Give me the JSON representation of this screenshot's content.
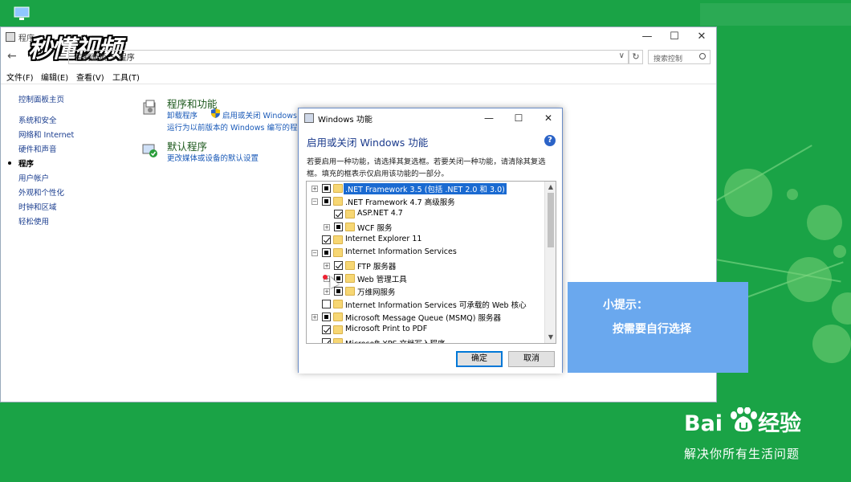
{
  "brand": {
    "watermark": "秒懂视频",
    "baidu_prefix": "Bai",
    "baidu_suffix": "经验",
    "baidu_slogan": "解决你所有生活问题"
  },
  "control_panel": {
    "title": "程序",
    "address_path": "控制面板 > 程序",
    "search_placeholder": "搜索控制",
    "menu": [
      "文件(F)",
      "编辑(E)",
      "查看(V)",
      "工具(T)"
    ],
    "sidebar": [
      {
        "label": "控制面板主页",
        "active": false
      },
      {
        "label": "系统和安全",
        "active": false
      },
      {
        "label": "网络和 Internet",
        "active": false
      },
      {
        "label": "硬件和声音",
        "active": false
      },
      {
        "label": "程序",
        "active": true
      },
      {
        "label": "用户帐户",
        "active": false
      },
      {
        "label": "外观和个性化",
        "active": false
      },
      {
        "label": "时钟和区域",
        "active": false
      },
      {
        "label": "轻松使用",
        "active": false
      }
    ],
    "programs_section": {
      "title": "程序和功能",
      "link_uninstall": "卸载程序",
      "link_features": "启用或关闭 Windows",
      "link_compat": "运行为以前版本的 Windows 编写的程"
    },
    "defaults_section": {
      "title": "默认程序",
      "link_media": "更改媒体或设备的默认设置"
    }
  },
  "dialog": {
    "title": "Windows 功能",
    "heading": "启用或关闭 Windows 功能",
    "desc_line1": "若要启用一种功能，请选择其复选框。若要关闭一种功能，请清除其复选",
    "desc_line2": "框。填充的框表示仅启用该功能的一部分。",
    "help_glyph": "?",
    "features": [
      {
        "label": ".NET Framework 3.5 (包括 .NET 2.0 和 3.0)",
        "state": "partial",
        "expander": "+",
        "level": 0,
        "selected": true
      },
      {
        "label": ".NET Framework 4.7 高级服务",
        "state": "partial",
        "expander": "−",
        "level": 0,
        "selected": false
      },
      {
        "label": "ASP.NET 4.7",
        "state": "checked",
        "expander": "",
        "level": 1,
        "selected": false
      },
      {
        "label": "WCF 服务",
        "state": "partial",
        "expander": "+",
        "level": 1,
        "selected": false
      },
      {
        "label": "Internet Explorer 11",
        "state": "checked",
        "expander": "",
        "level": 0,
        "selected": false
      },
      {
        "label": "Internet Information Services",
        "state": "partial",
        "expander": "−",
        "level": 0,
        "selected": false
      },
      {
        "label": "FTP 服务器",
        "state": "checked",
        "expander": "+",
        "level": 1,
        "selected": false
      },
      {
        "label": "Web 管理工具",
        "state": "partial",
        "expander": "+",
        "level": 1,
        "selected": false
      },
      {
        "label": "万维网服务",
        "state": "partial",
        "expander": "+",
        "level": 1,
        "selected": false
      },
      {
        "label": "Internet Information Services 可承载的 Web 核心",
        "state": "empty",
        "expander": "",
        "level": 0,
        "selected": false
      },
      {
        "label": "Microsoft Message Queue (MSMQ) 服务器",
        "state": "partial",
        "expander": "+",
        "level": 0,
        "selected": false
      },
      {
        "label": "Microsoft Print to PDF",
        "state": "checked",
        "expander": "",
        "level": 0,
        "selected": false
      },
      {
        "label": "Microsoft XPS 文档写入程序",
        "state": "checked",
        "expander": "",
        "level": 0,
        "selected": false
      }
    ],
    "ok_label": "确定",
    "cancel_label": "取消"
  },
  "tip": {
    "title": "小提示：",
    "body": "按需要自行选择"
  },
  "colors": {
    "background": "#1aa346",
    "tip_box": "#6aa8ee",
    "selection": "#1a6ad1",
    "heading_blue": "#1a3a8c"
  }
}
